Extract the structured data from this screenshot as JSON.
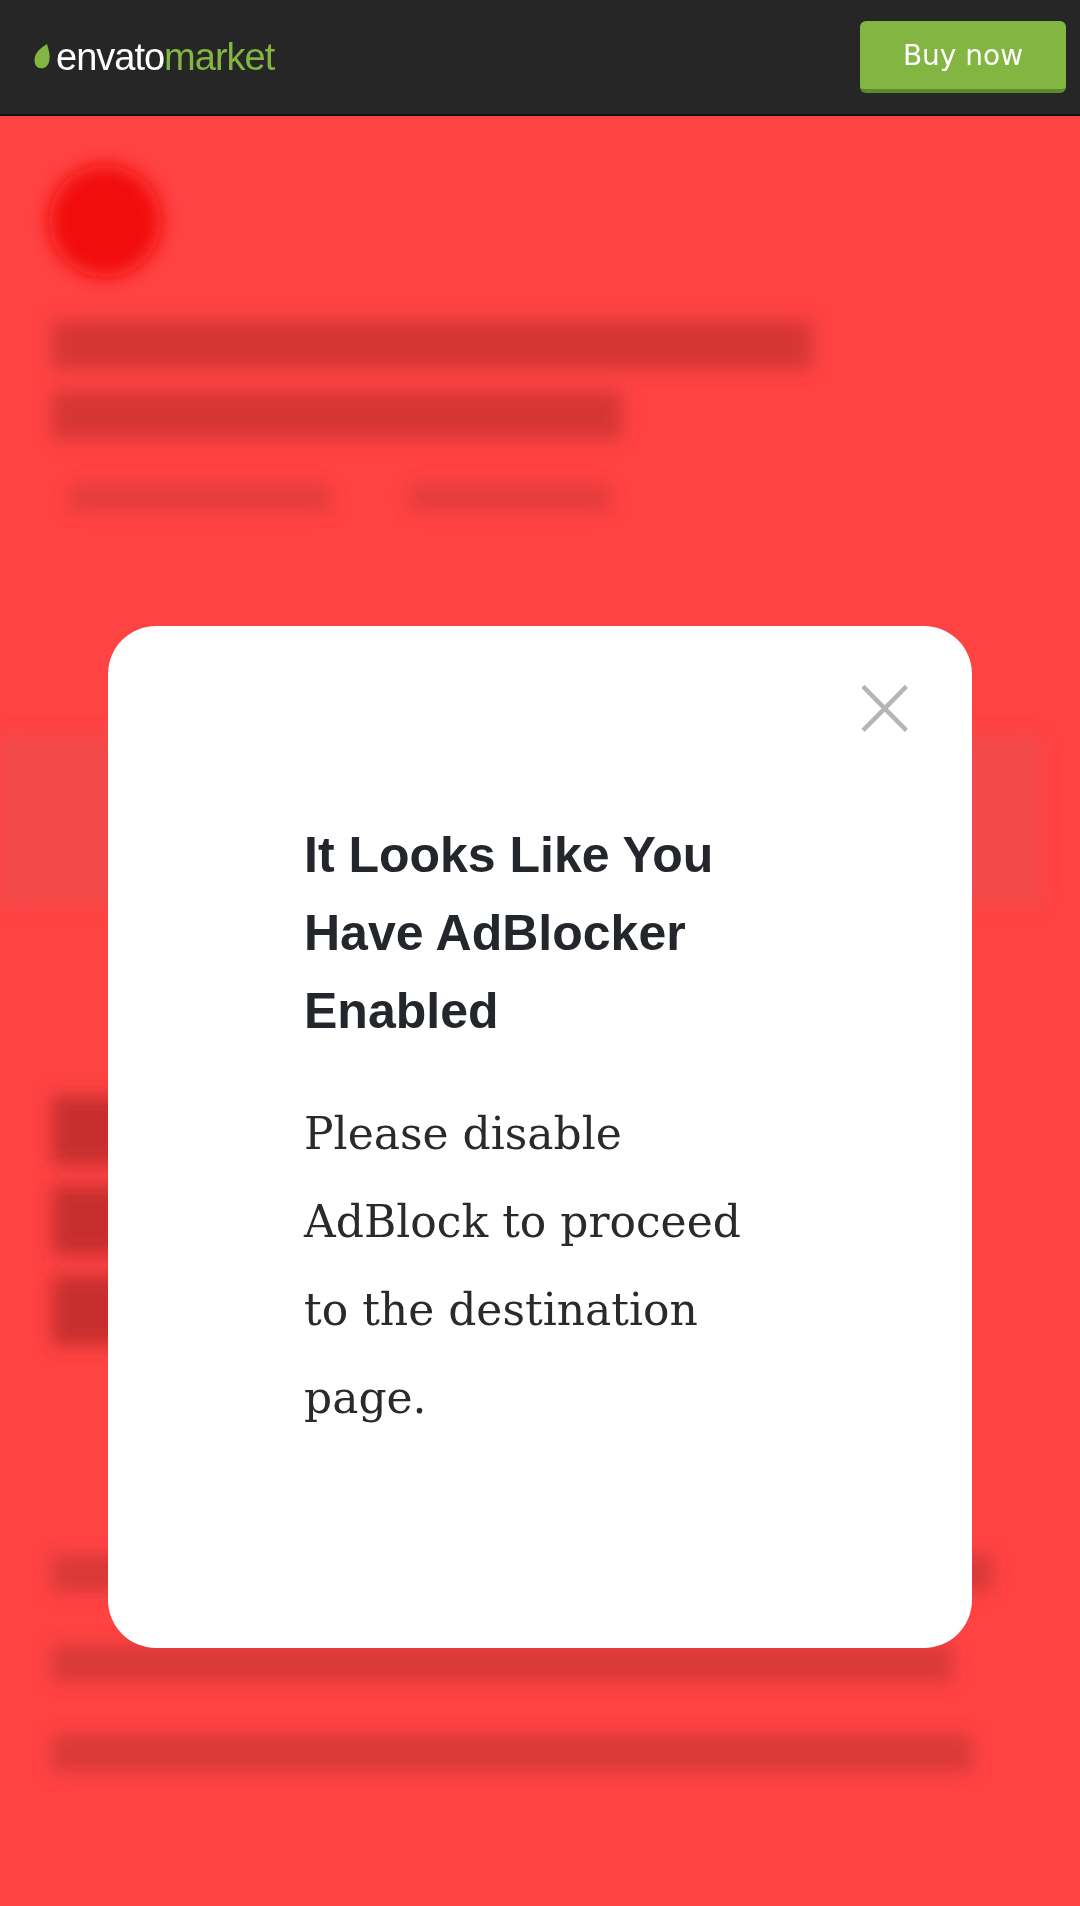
{
  "header": {
    "logo": {
      "name": "envato",
      "suffix": "market"
    },
    "button": "Buy now"
  },
  "modal": {
    "close": "×",
    "title": "It Looks Like You Have AdBlocker Enabled",
    "message": "Please disable AdBlock to proceed to the destination page."
  }
}
